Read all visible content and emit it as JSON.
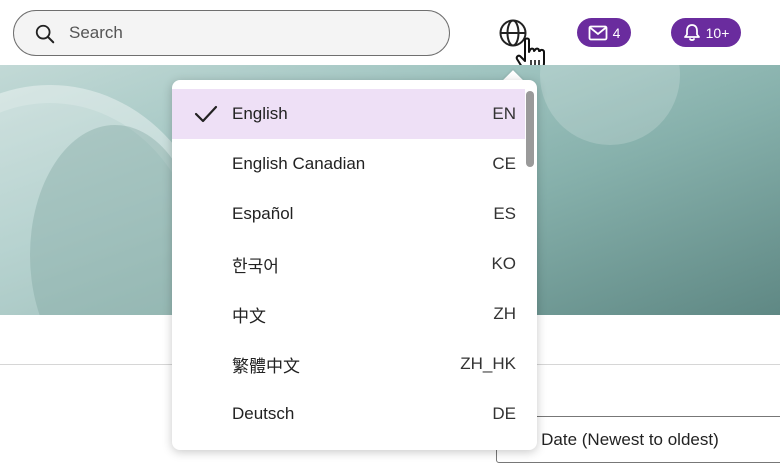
{
  "search": {
    "placeholder": "Search"
  },
  "header": {
    "mail_count": "4",
    "notification_count": "10+"
  },
  "language_menu": {
    "items": [
      {
        "label": "English",
        "code": "EN",
        "selected": true
      },
      {
        "label": "English Canadian",
        "code": "CE",
        "selected": false
      },
      {
        "label": "Español",
        "code": "ES",
        "selected": false
      },
      {
        "label": "한국어",
        "code": "KO",
        "selected": false
      },
      {
        "label": "中文",
        "code": "ZH",
        "selected": false
      },
      {
        "label": "繁體中文",
        "code": "ZH_HK",
        "selected": false
      },
      {
        "label": "Deutsch",
        "code": "DE",
        "selected": false
      }
    ]
  },
  "sort": {
    "label": "t by Date (Newest to oldest)"
  },
  "colors": {
    "accent": "#6a2c9e",
    "selected_bg": "#eee0f6"
  }
}
